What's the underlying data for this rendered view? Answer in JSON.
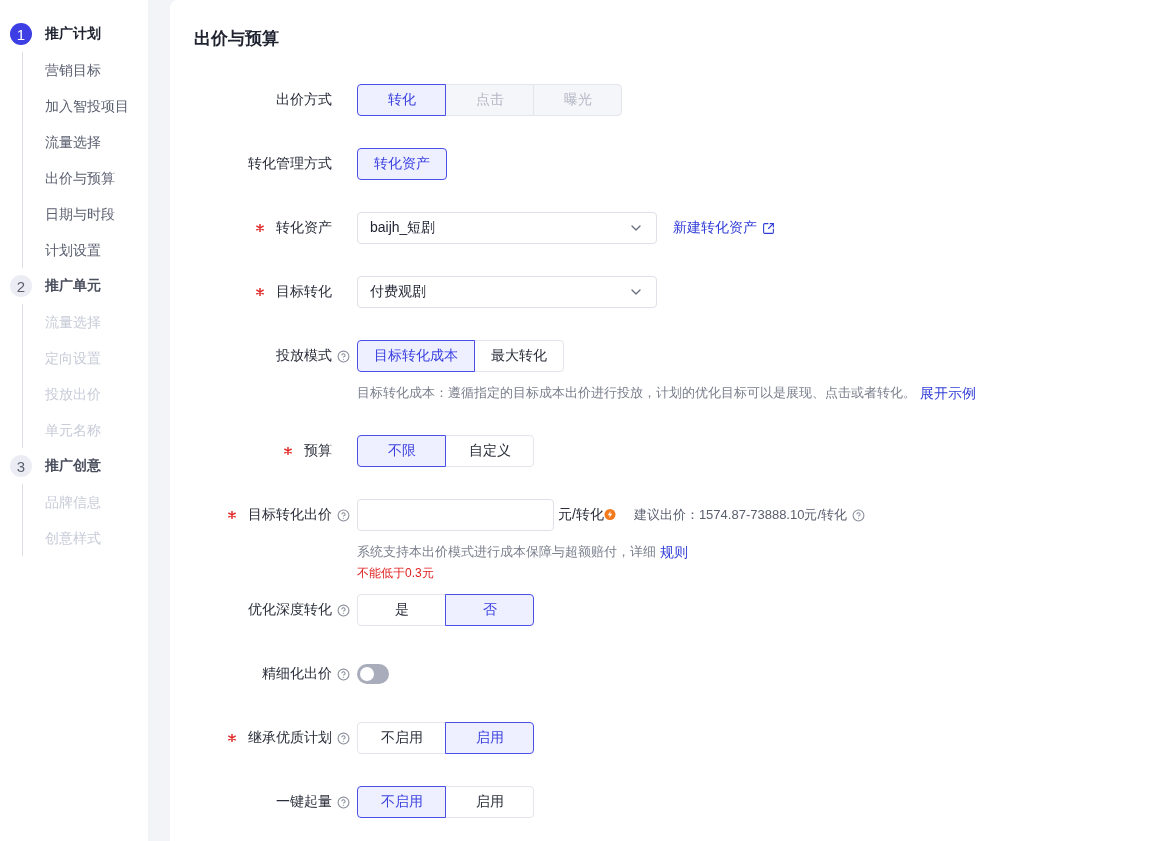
{
  "sidebar": {
    "steps": [
      {
        "number": "1",
        "title": "推广计划",
        "active": true,
        "items": [
          {
            "label": "营销目标",
            "disabled": false
          },
          {
            "label": "加入智投项目",
            "disabled": false
          },
          {
            "label": "流量选择",
            "disabled": false
          },
          {
            "label": "出价与预算",
            "disabled": false
          },
          {
            "label": "日期与时段",
            "disabled": false
          },
          {
            "label": "计划设置",
            "disabled": false
          }
        ]
      },
      {
        "number": "2",
        "title": "推广单元",
        "active": false,
        "items": [
          {
            "label": "流量选择",
            "disabled": true
          },
          {
            "label": "定向设置",
            "disabled": true
          },
          {
            "label": "投放出价",
            "disabled": true
          },
          {
            "label": "单元名称",
            "disabled": true
          }
        ]
      },
      {
        "number": "3",
        "title": "推广创意",
        "active": false,
        "items": [
          {
            "label": "品牌信息",
            "disabled": true
          },
          {
            "label": "创意样式",
            "disabled": true
          }
        ]
      }
    ]
  },
  "section": {
    "title": "出价与预算",
    "fields": [
      {
        "label": "出价方式",
        "required": false,
        "help": false,
        "kind": "segmented",
        "options": [
          {
            "label": "转化",
            "selected": true,
            "disabled": false
          },
          {
            "label": "点击",
            "selected": false,
            "disabled": true
          },
          {
            "label": "曝光",
            "selected": false,
            "disabled": true
          }
        ]
      },
      {
        "label": "转化管理方式",
        "required": false,
        "help": false,
        "kind": "segmented",
        "options": [
          {
            "label": "转化资产",
            "selected": true,
            "disabled": false
          }
        ]
      },
      {
        "label": "转化资产",
        "required": true,
        "help": false,
        "kind": "select",
        "value": "baijh_短剧",
        "link": "新建转化资产"
      },
      {
        "label": "目标转化",
        "required": true,
        "help": false,
        "kind": "select",
        "value": "付费观剧"
      },
      {
        "label": "投放模式",
        "required": false,
        "help": true,
        "kind": "segmented",
        "options": [
          {
            "label": "目标转化成本",
            "selected": true,
            "disabled": false
          },
          {
            "label": "最大转化",
            "selected": false,
            "disabled": false
          }
        ],
        "note": {
          "text": "目标转化成本：遵循指定的目标成本出价进行投放，计划的优化目标可以是展现、点击或者转化。",
          "link": "展开示例"
        }
      },
      {
        "label": "预算",
        "required": true,
        "help": false,
        "kind": "segmented",
        "options": [
          {
            "label": "不限",
            "selected": true,
            "disabled": false
          },
          {
            "label": "自定义",
            "selected": false,
            "disabled": false
          }
        ]
      },
      {
        "label": "目标转化出价",
        "required": true,
        "help": true,
        "kind": "input",
        "unit": "元/转化",
        "suggestion": "建议出价：1574.87-73888.10元/转化",
        "note": {
          "text": "系统支持本出价模式进行成本保障与超额赔付，详细",
          "link": "规则"
        },
        "error": "不能低于0.3元"
      },
      {
        "label": "优化深度转化",
        "required": false,
        "help": true,
        "kind": "segmented",
        "options": [
          {
            "label": "是",
            "selected": false,
            "disabled": false
          },
          {
            "label": "否",
            "selected": true,
            "disabled": false
          }
        ]
      },
      {
        "label": "精细化出价",
        "required": false,
        "help": true,
        "kind": "switch",
        "on": false
      },
      {
        "label": "继承优质计划",
        "required": true,
        "help": true,
        "kind": "segmented",
        "options": [
          {
            "label": "不启用",
            "selected": false,
            "disabled": false
          },
          {
            "label": "启用",
            "selected": true,
            "disabled": false
          }
        ]
      },
      {
        "label": "一键起量",
        "required": false,
        "help": true,
        "kind": "segmented",
        "options": [
          {
            "label": "不启用",
            "selected": true,
            "disabled": false
          },
          {
            "label": "启用",
            "selected": false,
            "disabled": false
          }
        ]
      }
    ]
  }
}
